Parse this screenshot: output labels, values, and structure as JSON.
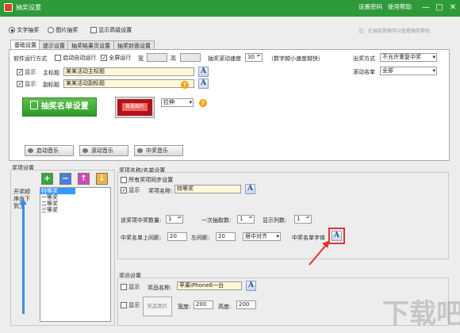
{
  "window": {
    "title": "抽奖设置",
    "settings_password": "设置密码",
    "help": "使用帮助",
    "controls": [
      "—",
      "□",
      "✕"
    ]
  },
  "mode": {
    "text_draw": "文字抽奖",
    "image_draw": "图片抽奖",
    "advanced": "显示高级设置",
    "note": "注：在抽奖界面可以查看抽奖帮助"
  },
  "tabs": [
    "基础设置",
    "提示设置",
    "抽奖结果页设置",
    "抽奖封面设置"
  ],
  "basic": {
    "run_mode_label": "软件运行方式",
    "auto_start": "启动自动运行",
    "fullscreen": "全屏运行",
    "width_label": "宽",
    "height_label": "高",
    "speed_label": "抽奖滚动速度",
    "speed_value": "30",
    "speed_hint": "（数字越小速度越快）",
    "show": "显示",
    "main_title_label": "主标题",
    "main_title_value": "某某活动主标题",
    "sub_title_label": "副标题",
    "sub_title_value": "某某活动副标题",
    "list_button": "抽奖名单设置",
    "bg_button": "背景图片",
    "stretch": "拉伸",
    "output_label": "出奖方式",
    "output_value": "不允许重复中奖",
    "roll_label": "滚动名单",
    "roll_value": "全部",
    "music_start": "启动音乐",
    "music_roll": "滚动音乐",
    "music_win": "中奖音乐"
  },
  "prize_setting": {
    "title": "奖项设置",
    "side_label": "开奖顺序由下到上",
    "tool_buttons": [
      "+",
      "−",
      "↑",
      "↓"
    ],
    "items": [
      "特等奖",
      "一等奖",
      "二等奖",
      "三等奖"
    ]
  },
  "prize_name": {
    "title": "奖项名称/名单设置",
    "sync_all": "所有奖项同步设置",
    "show": "显示",
    "name_label": "奖项名称:",
    "name_value": "特等奖",
    "count_label": "该奖项中奖数量:",
    "count_value": "1",
    "per_draw_label": "一次抽取数:",
    "per_draw_value": "1",
    "cols_label": "显示列数:",
    "cols_value": "1",
    "top_margin_label": "中奖名单上间距:",
    "top_margin_value": "20",
    "left_margin_label": "左间距:",
    "left_margin_value": "20",
    "align_value": "居中对齐",
    "font_label": "中奖名单字体"
  },
  "gift": {
    "title": "奖品设置",
    "show1": "显示",
    "name_label": "奖品名称:",
    "name_value": "苹果iPhone6一台",
    "show2": "显示",
    "image_button": "奖品图片",
    "width_label": "宽度:",
    "width_value": "200",
    "height_label": "高度:",
    "height_value": "200"
  },
  "watermark": "下载吧",
  "colors": {
    "titlebar": "#2f9a3a",
    "accent_red": "#e0332f",
    "list_button_green": "#3caa34",
    "highlight_blue": "#3399ff"
  }
}
